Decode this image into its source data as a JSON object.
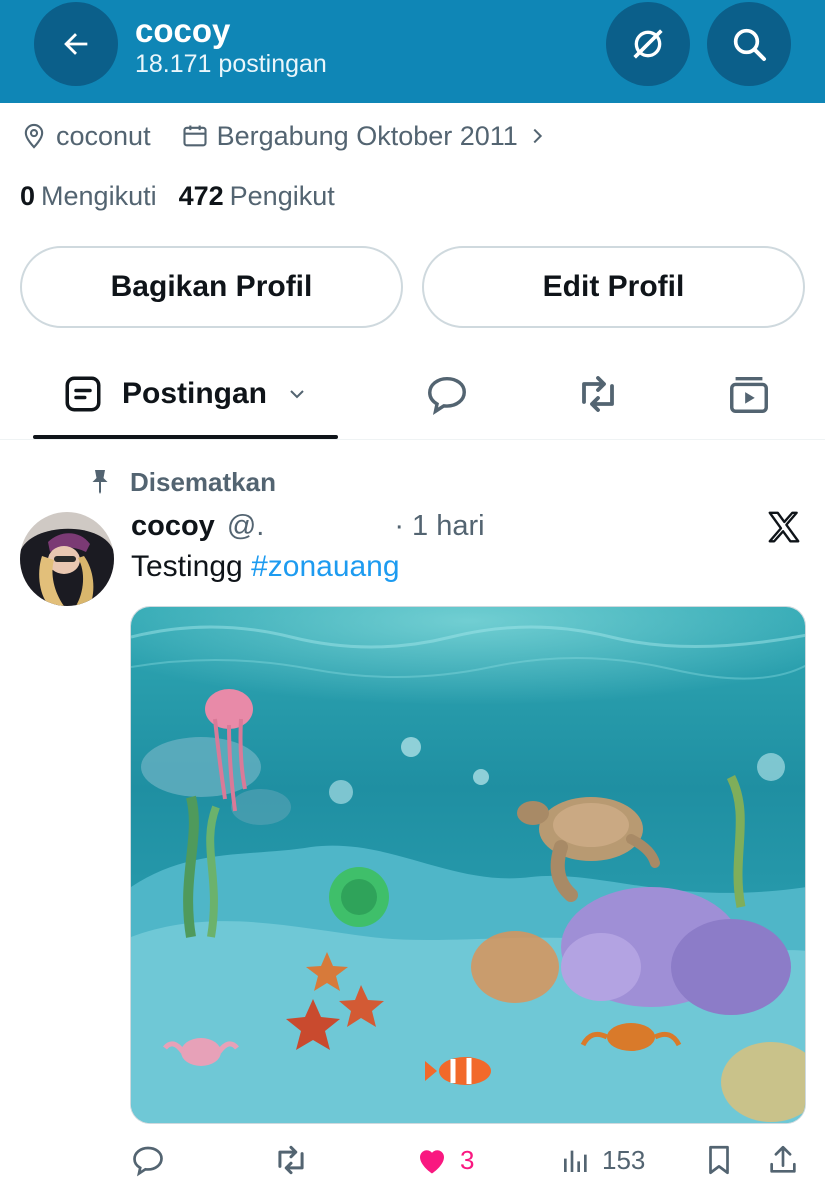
{
  "header": {
    "title": "cocoy",
    "post_count": "18.171 postingan",
    "back_icon": "arrow-left-icon",
    "grok_icon": "grok-icon",
    "search_icon": "search-icon",
    "bg_color": "#0f86b6"
  },
  "profile": {
    "location": "coconut",
    "joined": "Bergabung Oktober 2011",
    "following_count": "0",
    "following_label": "Mengikuti",
    "followers_count": "472",
    "followers_label": "Pengikut"
  },
  "buttons": {
    "share_label": "Bagikan Profil",
    "edit_label": "Edit Profil"
  },
  "tabs": {
    "posts_label": "Postingan",
    "icons": [
      "post-icon",
      "reply-icon",
      "repost-icon",
      "media-icon"
    ]
  },
  "post": {
    "pinned_label": "Disematkan",
    "author": "cocoy",
    "handle": "@.",
    "time": "· 1 hari",
    "text": "Testingg ",
    "hashtag": "#zonauang",
    "media_alt": "underwater-aquarium-image",
    "likes": "3",
    "views": "153"
  },
  "colors": {
    "accent": "#1d9bf0",
    "like": "#f91880",
    "muted": "#536471"
  }
}
